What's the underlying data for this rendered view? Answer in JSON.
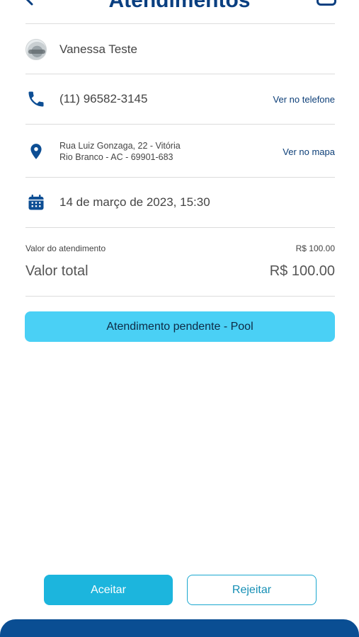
{
  "header": {
    "title": "Atendimentos"
  },
  "client": {
    "name": "Vanessa Teste"
  },
  "phone": {
    "number": "(11) 96582-3145",
    "link": "Ver no telefone"
  },
  "address": {
    "line1": "Rua Luiz Gonzaga, 22 - Vitória",
    "line2": "Rio Branco - AC - 69901-683",
    "link": "Ver no mapa"
  },
  "schedule": {
    "datetime": "14 de março de 2023, 15:30"
  },
  "pricing": {
    "service_label": "Valor do atendimento",
    "service_value": "R$ 100.00",
    "total_label": "Valor total",
    "total_value": "R$ 100.00"
  },
  "status": {
    "label": "Atendimento pendente - Pool"
  },
  "actions": {
    "accept": "Aceitar",
    "reject": "Rejeitar"
  },
  "colors": {
    "primary": "#0a4e93",
    "accent": "#1cb5dd",
    "status_bg": "#4ad0f5",
    "icon": "#0d4e94"
  },
  "icons": [
    "back-arrow-icon",
    "calendar-icon",
    "avatar",
    "phone-icon",
    "location-pin-icon",
    "calendar-icon"
  ]
}
